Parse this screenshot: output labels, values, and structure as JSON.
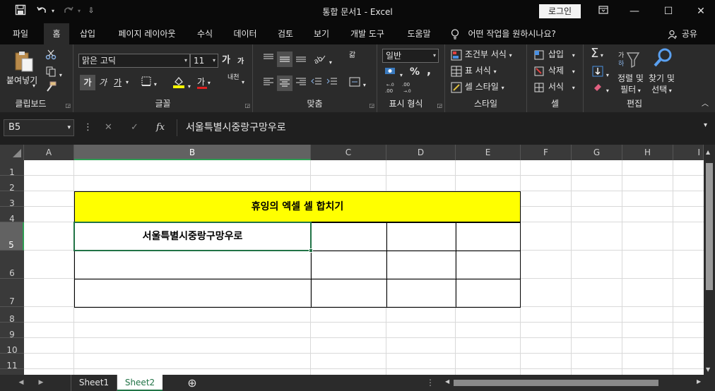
{
  "titlebar": {
    "title": "통합 문서1  -  Excel",
    "login": "로그인",
    "icons": [
      "save-icon",
      "undo-icon",
      "redo-icon",
      "customize-icon",
      "ribbon-display-icon",
      "minimize-icon",
      "maximize-icon",
      "close-icon"
    ]
  },
  "tabs": {
    "items": [
      "파일",
      "홈",
      "삽입",
      "페이지 레이아웃",
      "수식",
      "데이터",
      "검토",
      "보기",
      "개발 도구",
      "도움말"
    ],
    "active": "홈",
    "tellme": "어떤 작업을 원하시나요?",
    "share": "공유"
  },
  "ribbon": {
    "clipboard": {
      "label": "클립보드",
      "paste": "붙여넣기"
    },
    "font": {
      "label": "글꼴",
      "font_name": "맑은 고딕",
      "font_size": "11",
      "grow": "가",
      "shrink": "가",
      "bold": "가",
      "italic": "가",
      "underline": "가",
      "fontcolor": "가",
      "phonetic": "내천"
    },
    "alignment": {
      "label": "맞춤",
      "wrap": "갊"
    },
    "number": {
      "label": "표시 형식",
      "format": "일반",
      "percent": "%",
      "comma": ",",
      "inc_decimal": ".00\n→.0",
      "dec_decimal": ".00\n←.0"
    },
    "styles": {
      "label": "스타일",
      "conditional": "조건부 서식",
      "table": "표 서식",
      "cell": "셀 스타일"
    },
    "cells": {
      "label": "셀",
      "insert": "삽입",
      "delete": "삭제",
      "format": "서식"
    },
    "editing": {
      "label": "편집",
      "sort_filter_1": "정렬 및",
      "sort_filter_2": "필터",
      "find_1": "찾기 및",
      "find_2": "선택"
    }
  },
  "formula_bar": {
    "name_box": "B5",
    "formula": "서울특별시중랑구망우로",
    "fx": "fx"
  },
  "grid": {
    "columns": [
      "A",
      "B",
      "C",
      "D",
      "E",
      "F",
      "G",
      "H",
      "I"
    ],
    "rows": [
      "1",
      "2",
      "3",
      "4",
      "5",
      "6",
      "7",
      "8",
      "9",
      "10",
      "11"
    ],
    "selected_col": "B",
    "selected_row": "5",
    "merged_title": "휴잉의 엑셀 셀 합치기",
    "b5": "서울특별시중랑구망우로"
  },
  "sheets": {
    "items": [
      "Sheet1",
      "Sheet2"
    ],
    "active": "Sheet2",
    "add": "⊕"
  },
  "colors": {
    "accent_green": "#217346",
    "title_fill": "#ffff00",
    "dark_bg": "#1f1f1f"
  }
}
